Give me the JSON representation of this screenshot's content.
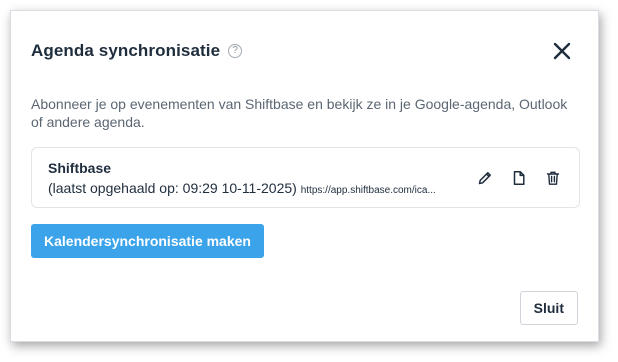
{
  "dialog": {
    "title": "Agenda synchronisatie",
    "help_icon": "question-circle-icon",
    "help_glyph": "?",
    "close_icon": "close-icon",
    "description": "Abonneer je op evenementen van Shiftbase en bekijk ze in je Google-agenda, Outlook of andere agenda."
  },
  "calendar_items": [
    {
      "name": "Shiftbase",
      "last_fetched": "(laatst opgehaald op: 09:29 10-11-2025)",
      "url": "https://app.shiftbase.com/ica...",
      "actions": [
        "edit-icon",
        "copy-file-icon",
        "delete-icon"
      ]
    }
  ],
  "buttons": {
    "create_label": "Kalendersynchronisatie maken",
    "close_label": "Sluit"
  },
  "colors": {
    "primary": "#3aa3ea",
    "title_text": "#1f2d3d",
    "muted_text": "#5b6673"
  }
}
